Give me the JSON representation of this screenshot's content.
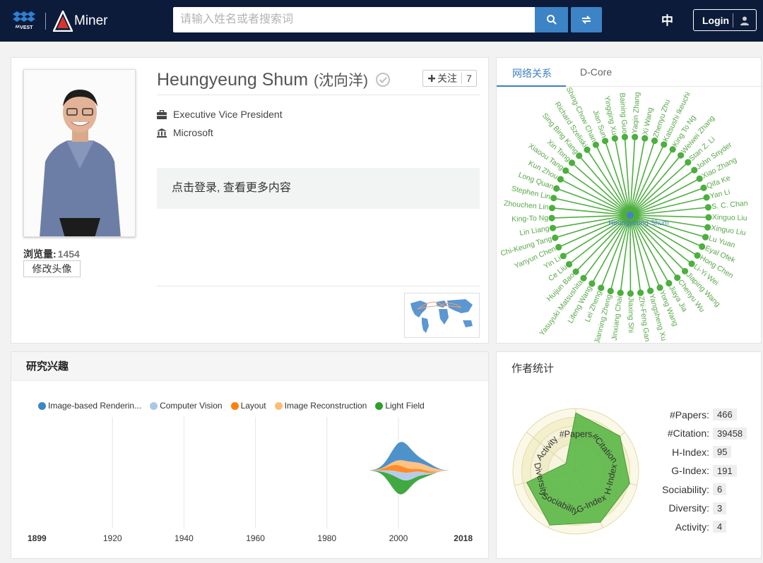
{
  "header": {
    "logo_text": "Miner",
    "search_placeholder": "请输入姓名或者搜索词",
    "lang_label": "中",
    "login_label": "Login"
  },
  "profile": {
    "name": "Heungyeung Shum",
    "name_zh": "(沈向洋)",
    "follow_label": "关注",
    "follow_count": "7",
    "position": "Executive Vice President",
    "affiliation": "Microsoft",
    "views_label": "浏览量:",
    "views_count": "1454",
    "edit_avatar_label": "修改头像",
    "login_tip": "点击登录, 查看更多内容"
  },
  "network": {
    "tabs": [
      {
        "label": "网络关系",
        "active": true
      },
      {
        "label": "D-Core",
        "active": false
      }
    ],
    "center": "Heungyeung Shum",
    "color": "#4caf3e",
    "nodes": [
      "Yaqin Zhang",
      "Xi Wang",
      "Zhenyu Zhu",
      "Katsushi Ikeuchi",
      "King To Ng",
      "Weiwei Zhang",
      "Stan Z. Li",
      "John Snyder",
      "Xiao Zhang",
      "Qifa Ke",
      "Yan Li",
      "S. C. Chan",
      "Xinguo Liu",
      "Xinguo Liu",
      "Lu Yuan",
      "Eyal Ofek",
      "Hong Chen",
      "Li-Yi Wei",
      "Jiaping Wang",
      "Chenyu Wu",
      "Jiaya Jia",
      "Yong Wang",
      "Yangsheng Xu",
      "Zhi-Feng Gan",
      "Jiaxing Shi",
      "Jinxiang Chai",
      "Jianning Zheng",
      "Lei Zheng",
      "Lifeng Wang",
      "Yasuyuki Matsushita",
      "Huijun Bao",
      "Ce Liu",
      "Yin Li",
      "Yanyun Chen",
      "Chi-Keung Tang",
      "Lin Liang",
      "King-To Ng",
      "Zhouchen Lin",
      "Stephen Lin",
      "Long Quan",
      "Kun Zhou",
      "Xiaoou Tang",
      "Xin Tong",
      "Sing Bing Kang",
      "Richard Szeliski",
      "Shing-Chow Chan",
      "Jian Sun",
      "Yingqing Xu",
      "Baining Guo"
    ]
  },
  "interests": {
    "title": "研究兴趣",
    "chart_data": {
      "type": "area",
      "series": [
        {
          "name": "Image-based Renderin...",
          "color": "#3b86c4"
        },
        {
          "name": "Computer Vision",
          "color": "#aec7e8"
        },
        {
          "name": "Layout",
          "color": "#ff7f0e"
        },
        {
          "name": "Image Reconstruction",
          "color": "#ffbb78"
        },
        {
          "name": "Light Field",
          "color": "#2ca02c"
        }
      ],
      "x_ticks": [
        {
          "label": "1899",
          "value": 1899,
          "bold": true
        },
        {
          "label": "1920",
          "value": 1920,
          "bold": false
        },
        {
          "label": "1940",
          "value": 1940,
          "bold": false
        },
        {
          "label": "1960",
          "value": 1960,
          "bold": false
        },
        {
          "label": "1980",
          "value": 1980,
          "bold": false
        },
        {
          "label": "2000",
          "value": 2000,
          "bold": false
        },
        {
          "label": "2018",
          "value": 2018,
          "bold": true
        }
      ],
      "xlim": [
        1899,
        2018
      ]
    }
  },
  "stats": {
    "title": "作者统计",
    "chart_data": {
      "type": "radar",
      "axes": [
        "#Papers",
        "#Citation",
        "H-Index",
        "G-Index",
        "Sociability",
        "Diversity",
        "Activity"
      ],
      "values": [
        0.93,
        0.9,
        0.88,
        0.9,
        0.95,
        0.8,
        0.2
      ],
      "fill": "#5db84a"
    },
    "rows": [
      {
        "label": "#Papers:",
        "value": "466"
      },
      {
        "label": "#Citation:",
        "value": "39458"
      },
      {
        "label": "H-Index:",
        "value": "95"
      },
      {
        "label": "G-Index:",
        "value": "191"
      },
      {
        "label": "Sociability:",
        "value": "6"
      },
      {
        "label": "Diversity:",
        "value": "3"
      },
      {
        "label": "Activity:",
        "value": "4"
      }
    ]
  }
}
